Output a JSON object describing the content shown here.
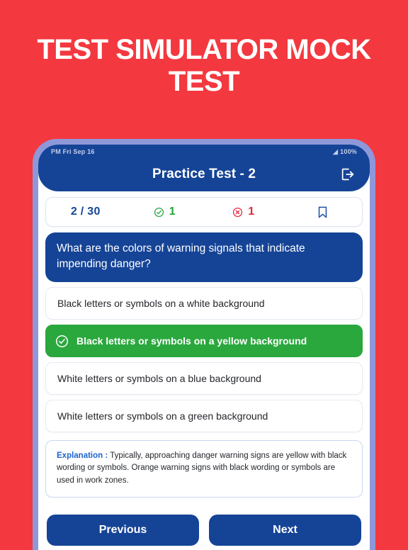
{
  "promo": {
    "headline": "TEST SIMULATOR MOCK TEST",
    "background_color": "#F4383F",
    "text_color": "#FFFFFF"
  },
  "phone": {
    "frame_color": "#8E97D8",
    "status_bar": {
      "time_and_date": "PM  Fri Sep 16",
      "wifi_icon": "wifi-icon",
      "battery_level": "100%"
    },
    "app_bar": {
      "title": "Practice Test - 2",
      "logout_icon": "logout-icon",
      "background_color": "#154497"
    }
  },
  "stats": {
    "progress": "2 / 30",
    "correct_icon": "check-circle-icon",
    "correct_count": "1",
    "wrong_icon": "x-circle-icon",
    "wrong_count": "1",
    "bookmark_icon": "bookmark-icon"
  },
  "question": {
    "text": "What are the colors of warning signals that indicate impending danger?"
  },
  "options": [
    {
      "label": "Black letters or symbols on a white background",
      "state": "plain"
    },
    {
      "label": "Black letters or symbols on a yellow background",
      "state": "correct",
      "icon": "check-circle-icon"
    },
    {
      "label": "White letters or symbols on a blue background",
      "state": "plain"
    },
    {
      "label": "White letters or symbols on a green background",
      "state": "plain"
    }
  ],
  "explanation": {
    "label": "Explanation :",
    "text": " Typically, approaching danger warning signs are yellow with black wording or symbols. Orange warning signs with black wording or symbols are used in work zones."
  },
  "nav": {
    "previous_label": "Previous",
    "next_label": "Next"
  },
  "colors": {
    "brand_red": "#F4383F",
    "brand_blue": "#154497",
    "correct_green": "#2AA83D",
    "wrong_red": "#E5263A",
    "frame_periwinkle": "#8E97D8"
  }
}
